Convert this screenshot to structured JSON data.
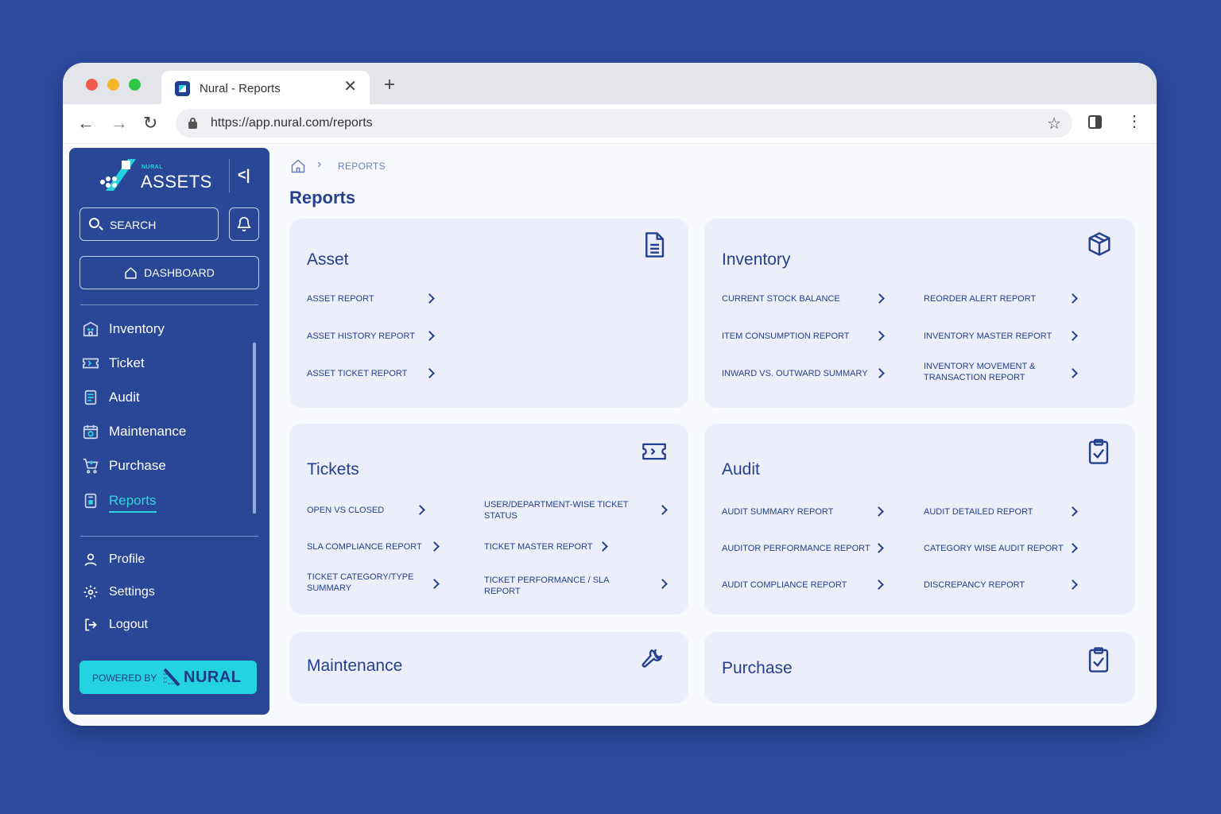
{
  "browser": {
    "tab_title": "Nural - Reports",
    "url": "https://app.nural.com/reports"
  },
  "sidebar": {
    "brand_small": "NURAL",
    "brand_name": "ASSETS",
    "search_label": "SEARCH",
    "dashboard_label": "DASHBOARD",
    "nav": [
      {
        "label": "Inventory",
        "icon": "building-icon"
      },
      {
        "label": "Ticket",
        "icon": "ticket-icon"
      },
      {
        "label": "Audit",
        "icon": "clipboard-icon"
      },
      {
        "label": "Maintenance",
        "icon": "calendar-gear-icon"
      },
      {
        "label": "Purchase",
        "icon": "cart-icon"
      },
      {
        "label": "Reports",
        "icon": "report-icon",
        "active": true
      }
    ],
    "account": [
      {
        "label": "Profile",
        "icon": "user-icon"
      },
      {
        "label": "Settings",
        "icon": "gear-icon"
      },
      {
        "label": "Logout",
        "icon": "logout-icon"
      }
    ],
    "powered_by": "POWERED BY",
    "powered_name": "NURAL"
  },
  "breadcrumb": {
    "current": "REPORTS"
  },
  "page": {
    "title": "Reports"
  },
  "cards": {
    "asset": {
      "title": "Asset",
      "icon": "document-icon",
      "links": [
        "ASSET REPORT",
        "ASSET HISTORY REPORT",
        "ASSET TICKET REPORT"
      ]
    },
    "inventory": {
      "title": "Inventory",
      "icon": "box-icon",
      "links_left": [
        "CURRENT STOCK BALANCE",
        "ITEM CONSUMPTION REPORT",
        "INWARD VS. OUTWARD SUMMARY"
      ],
      "links_right": [
        "REORDER ALERT REPORT",
        "INVENTORY MASTER REPORT",
        "INVENTORY MOVEMENT & TRANSACTION REPORT"
      ]
    },
    "tickets": {
      "title": "Tickets",
      "icon": "ticket-icon",
      "links_left": [
        "OPEN VS CLOSED",
        "SLA COMPLIANCE REPORT",
        "TICKET CATEGORY/TYPE SUMMARY"
      ],
      "links_right": [
        "USER/DEPARTMENT-WISE TICKET STATUS",
        "TICKET MASTER REPORT",
        "TICKET PERFORMANCE / SLA REPORT"
      ]
    },
    "audit": {
      "title": "Audit",
      "icon": "clipboard-check-icon",
      "links_left": [
        "AUDIT SUMMARY REPORT",
        "AUDITOR PERFORMANCE REPORT",
        "AUDIT COMPLIANCE REPORT"
      ],
      "links_right": [
        "AUDIT DETAILED REPORT",
        "CATEGORY WISE AUDIT REPORT",
        "DISCREPANCY REPORT"
      ]
    },
    "maintenance": {
      "title": "Maintenance",
      "icon": "wrench-icon"
    },
    "purchase": {
      "title": "Purchase",
      "icon": "clipboard-check-icon"
    }
  },
  "colors": {
    "background": "#2c4aa0",
    "sidebar": "#2a4696",
    "accent": "#23d3df",
    "primary_text": "#24408f",
    "card": "#eceff9"
  }
}
